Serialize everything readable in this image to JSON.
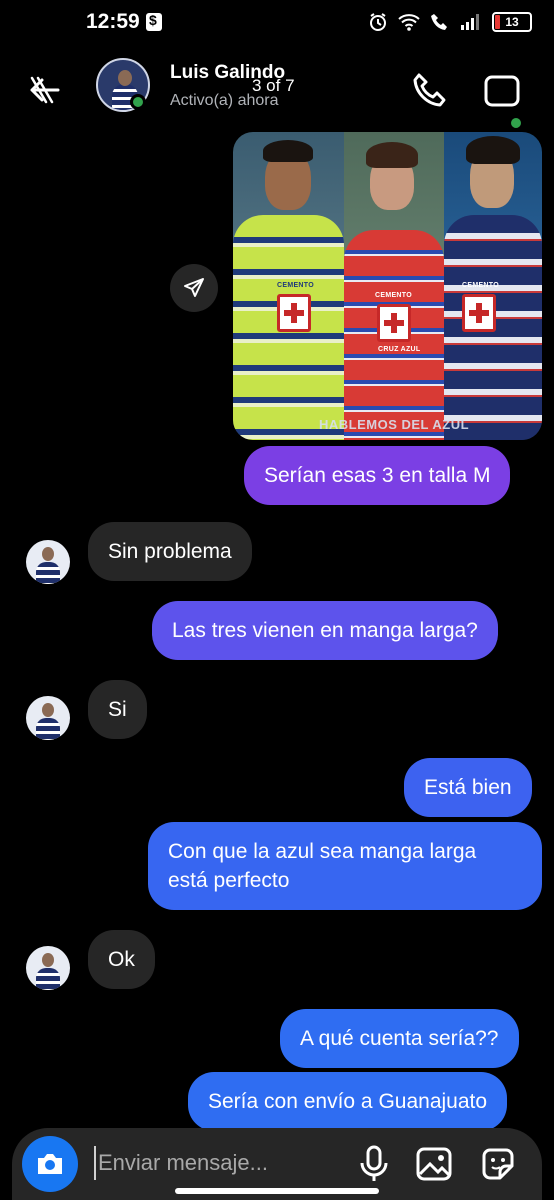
{
  "status_bar": {
    "time": "12:59",
    "battery": "13",
    "colors": {
      "battery_low": "#e53935"
    }
  },
  "header": {
    "contact_name": "Luis Galindo",
    "contact_status": "Activo(a) ahora",
    "page_counter": "3 of 7",
    "icons": [
      "back-arrow-icon",
      "phone-icon",
      "video-call-icon"
    ],
    "online_color": "#31a24c"
  },
  "shared_image": {
    "watermark": "HABLEMOS DEL AZUL",
    "jersey_label": "CEMENTO",
    "jersey_sublabel": "CRUZ AZUL"
  },
  "messages": [
    {
      "direction": "outgoing",
      "text": "Serían esas 3 en talla M"
    },
    {
      "direction": "incoming",
      "text": "Sin problema"
    },
    {
      "direction": "outgoing",
      "text": "Las tres vienen en manga larga?"
    },
    {
      "direction": "incoming",
      "text": "Si"
    },
    {
      "direction": "outgoing",
      "text": "Está bien"
    },
    {
      "direction": "outgoing",
      "line1": "Con que la azul sea manga larga",
      "line2": "está perfecto"
    },
    {
      "direction": "incoming",
      "text": "Ok"
    },
    {
      "direction": "outgoing",
      "text": "A qué cuenta sería??"
    },
    {
      "direction": "outgoing",
      "text": "Sería con envío a Guanajuato"
    }
  ],
  "composer": {
    "placeholder": "Enviar mensaje...",
    "icons": [
      "camera-icon",
      "microphone-icon",
      "gallery-icon",
      "sticker-icon"
    ]
  },
  "colors": {
    "outgoing_purple": "#7b3fe4",
    "outgoing_blue": "#2f6df2",
    "incoming_bubble": "#262626",
    "accent": "#1877f2"
  }
}
